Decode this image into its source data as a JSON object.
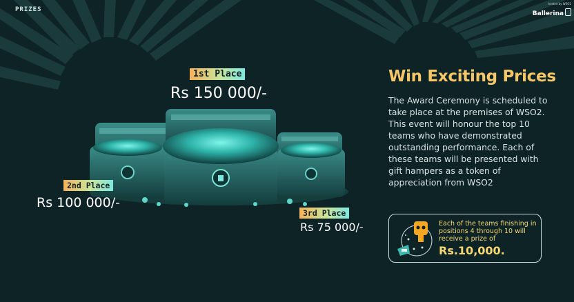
{
  "page": {
    "section_label": "PRIZES",
    "brand": {
      "small_text": "hosted by WSO2",
      "name": "Ballerina"
    }
  },
  "prizes": [
    {
      "place": "1st Place",
      "amount": "Rs 150 000/-"
    },
    {
      "place": "2nd Place",
      "amount": "Rs 100 000/-"
    },
    {
      "place": "3rd Place",
      "amount": "Rs 75 000/-"
    }
  ],
  "details": {
    "heading": "Win Exciting Prices",
    "description": "The Award Ceremony is scheduled to take place at the premises of WSO2. This event will honour the top 10 teams who have demonstrated outstanding performance. Each of these teams will be presented with gift hampers as a token of appreciation from WSO2",
    "info_box": {
      "text": "Each of the teams finishing in positions 4 through 10 will receive a prize of",
      "prize": "Rs.10,000."
    }
  },
  "icons": [
    "treasure-chests-illustration",
    "ballerina-logo-icon",
    "robot-mascot-icon"
  ],
  "colors": {
    "background": "#0e2326",
    "ray": "#1a3a3c",
    "heading": "#f6c767",
    "tag_gradient": [
      "#f5b259",
      "#c9e59b",
      "#7de8e0"
    ],
    "treasure_glow": "#37e0d0"
  }
}
